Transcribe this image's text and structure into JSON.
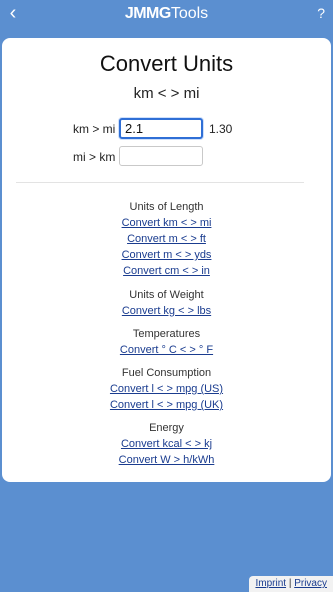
{
  "header": {
    "back_icon": "chevron-left-icon",
    "brand_bold": "JMMG",
    "brand_rest": "Tools",
    "help": "?"
  },
  "card": {
    "title": "Convert Units",
    "subtitle": "km < > mi",
    "rows": [
      {
        "label": "km > mi",
        "value": "2.1",
        "result": "1.30"
      },
      {
        "label": "mi > km",
        "value": "",
        "result": ""
      }
    ]
  },
  "sections": [
    {
      "title": "Units of Length",
      "links": [
        "Convert km < > mi",
        "Convert m < > ft",
        "Convert m < > yds",
        "Convert cm < > in"
      ]
    },
    {
      "title": "Units of Weight",
      "links": [
        "Convert kg < > lbs"
      ]
    },
    {
      "title": "Temperatures",
      "links": [
        "Convert ° C < > ° F"
      ]
    },
    {
      "title": "Fuel Consumption",
      "links": [
        "Convert l < > mpg (US)",
        "Convert l < > mpg (UK)"
      ]
    },
    {
      "title": "Energy",
      "links": [
        "Convert kcal < > kj",
        "Convert W > h/kWh"
      ]
    }
  ],
  "footer": {
    "imprint": "Imprint",
    "separator": "|",
    "privacy": "Privacy"
  },
  "colors": {
    "background": "#5b8fd0",
    "link": "#1a3c8f",
    "focus": "#2f6fd6"
  }
}
